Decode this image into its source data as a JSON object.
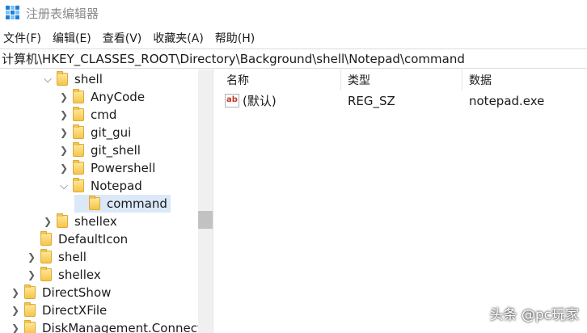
{
  "window": {
    "title": "注册表编辑器"
  },
  "menu": [
    "文件(F)",
    "编辑(E)",
    "查看(V)",
    "收藏夹(A)",
    "帮助(H)"
  ],
  "address": "计算机\\HKEY_CLASSES_ROOT\\Directory\\Background\\shell\\Notepad\\command",
  "tree": {
    "nodes": [
      {
        "label": "shell",
        "toggle": "down"
      },
      {
        "label": "AnyCode",
        "toggle": "right"
      },
      {
        "label": "cmd",
        "toggle": "right"
      },
      {
        "label": "git_gui",
        "toggle": "right"
      },
      {
        "label": "git_shell",
        "toggle": "right"
      },
      {
        "label": "Powershell",
        "toggle": "right"
      },
      {
        "label": "Notepad",
        "toggle": "down"
      },
      {
        "label": "command",
        "toggle": "none"
      },
      {
        "label": "shellex",
        "toggle": "right"
      },
      {
        "label": "DefaultIcon",
        "toggle": "none"
      },
      {
        "label": "shell",
        "toggle": "right"
      },
      {
        "label": "shellex",
        "toggle": "right"
      },
      {
        "label": "DirectShow",
        "toggle": "right"
      },
      {
        "label": "DirectXFile",
        "toggle": "right"
      },
      {
        "label": "DiskManagement.Connection",
        "toggle": "right"
      }
    ]
  },
  "list": {
    "columns": [
      "名称",
      "类型",
      "数据"
    ],
    "rows": [
      {
        "icon": "ab",
        "name": "(默认)",
        "type": "REG_SZ",
        "data": "notepad.exe"
      }
    ]
  },
  "watermark": "头条 @pc玩家",
  "colors": {
    "accent": "#1e7fd8",
    "selection": "#dbe8f7",
    "folder": "#f6c54a"
  }
}
